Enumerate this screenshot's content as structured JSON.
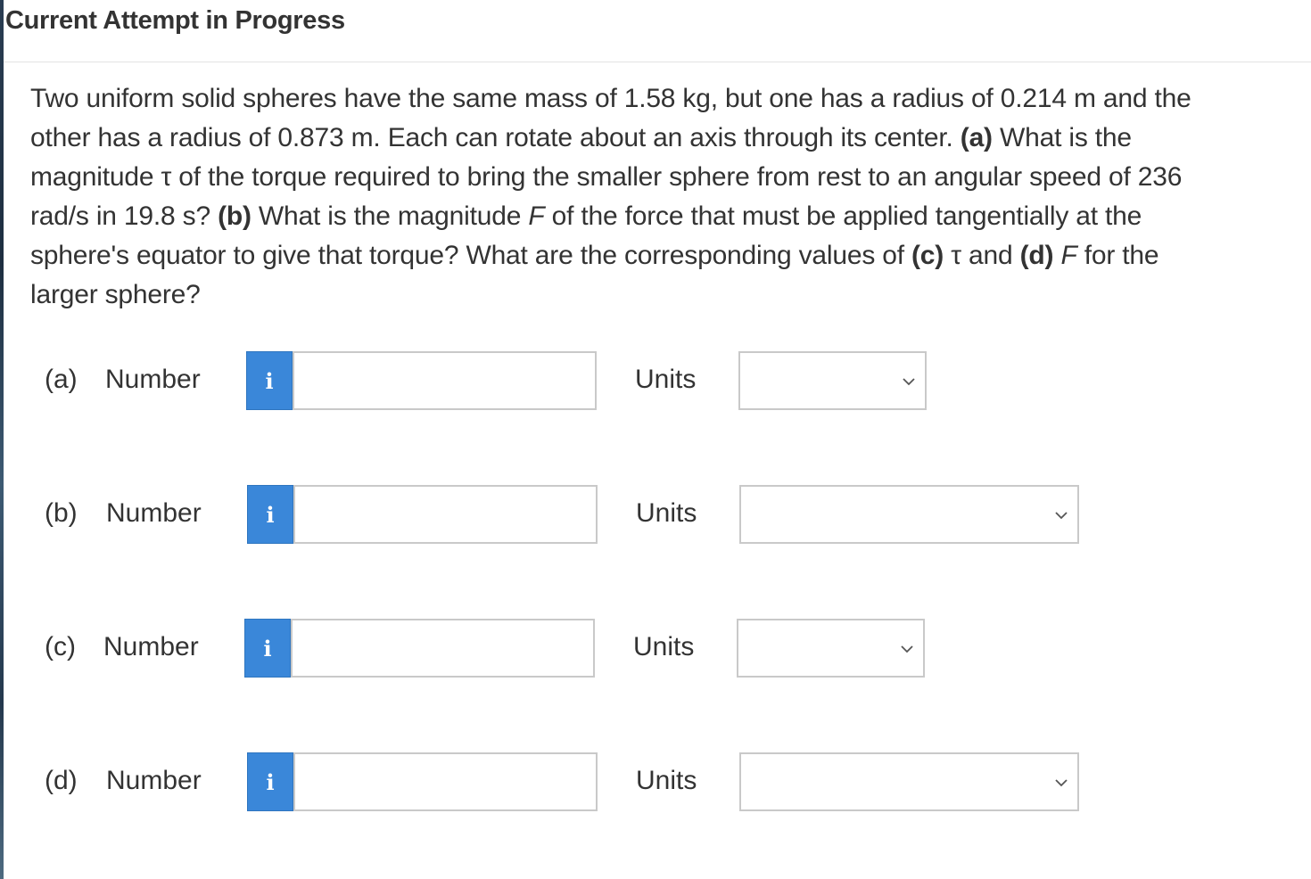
{
  "header": {
    "title": "Current Attempt in Progress"
  },
  "question": {
    "l1": "Two uniform solid spheres have the same mass of 1.58 kg, but one has a radius of 0.214 m and the",
    "l2a": "other has a radius of 0.873 m. Each can rotate about an axis through its center. ",
    "l2b": "(a)",
    "l2c": " What is the",
    "l3a": "magnitude ",
    "l3b": "τ",
    "l3c": " of the torque required to bring the smaller sphere from rest to an angular speed of 236",
    "l4a": "rad/s in 19.8 s? ",
    "l4b": "(b)",
    "l4c": " What is the magnitude ",
    "l4d": "F",
    "l4e": " of the force that must be applied tangentially at the",
    "l5a": "sphere's equator to give that torque? What are the corresponding values of ",
    "l5b": "(c)",
    "l5c": " τ and ",
    "l5d": "(d)",
    "l5e": " ",
    "l5f": "F",
    "l5g": " for the",
    "l6": "larger sphere?"
  },
  "parts": [
    {
      "letter": "(a)",
      "number_label": "Number",
      "info_icon": "i",
      "value": "",
      "units_label": "Units",
      "units_value": ""
    },
    {
      "letter": "(b)",
      "number_label": "Number",
      "info_icon": "i",
      "value": "",
      "units_label": "Units",
      "units_value": ""
    },
    {
      "letter": "(c)",
      "number_label": "Number",
      "info_icon": "i",
      "value": "",
      "units_label": "Units",
      "units_value": ""
    },
    {
      "letter": "(d)",
      "number_label": "Number",
      "info_icon": "i",
      "value": "",
      "units_label": "Units",
      "units_value": ""
    }
  ],
  "colors": {
    "info_button": "#3a87d9",
    "text": "#333333",
    "input_border": "#c9c9c9"
  }
}
